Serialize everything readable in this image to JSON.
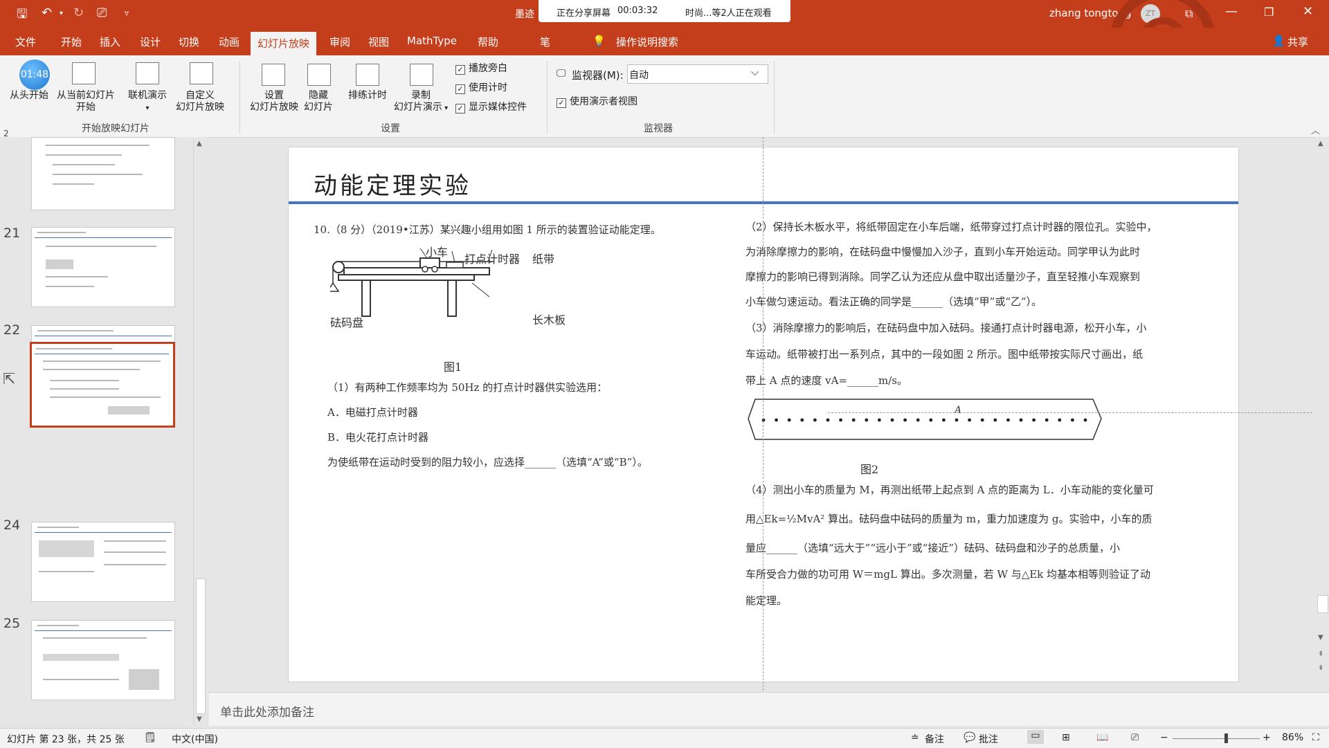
{
  "titlebar": {
    "doc_prefix": "墨迹",
    "share_status": "正在分享屏幕",
    "share_timer": "00:03:32",
    "viewers": "时尚...等2人正在观看",
    "user_name": "zhang tongtong",
    "user_initials": "ZT"
  },
  "tabs": [
    "文件",
    "开始",
    "插入",
    "设计",
    "切换",
    "动画",
    "幻灯片放映",
    "审阅",
    "视图",
    "MathType",
    "帮助",
    "笔"
  ],
  "active_tab": "幻灯片放映",
  "search_label": "操作说明搜索",
  "share_label": "共享",
  "ribbon": {
    "timer_badge": "01:48",
    "from_start": "从头开始",
    "from_current_1": "从当前幻灯片",
    "from_current_2": "开始",
    "online_1": "联机演示",
    "custom_1": "自定义",
    "custom_2": "幻灯片放映",
    "group_start": "开始放映幻灯片",
    "setup_1": "设置",
    "setup_2": "幻灯片放映",
    "hide_1": "隐藏",
    "hide_2": "幻灯片",
    "rehearse": "排练计时",
    "record_1": "录制",
    "record_2": "幻灯片演示",
    "chk_narration": "播放旁白",
    "chk_timing": "使用计时",
    "chk_media": "显示媒体控件",
    "group_setup": "设置",
    "monitor_label": "监视器(M):",
    "monitor_value": "自动",
    "chk_presenter": "使用演示者视图",
    "group_monitor": "监视器"
  },
  "thumbnails": [
    {
      "num": "",
      "selected": false
    },
    {
      "num": "21",
      "selected": false
    },
    {
      "num": "22",
      "selected": false
    },
    {
      "num": "",
      "selected": true
    },
    {
      "num": "24",
      "selected": false
    },
    {
      "num": "25",
      "selected": false
    }
  ],
  "slide": {
    "title": "动能定理实验",
    "q_intro": "10.（8 分）（2019•江苏）某兴趣小组用如图 1 所示的装置验证动能定理。",
    "fig1_cart": "小车",
    "fig1_timer": "打点计时器",
    "fig1_tape": "纸带",
    "fig1_weight": "砝码盘",
    "fig1_board": "长木板",
    "fig1_caption": "图1",
    "q1": "（1）有两种工作频率均为 50Hz 的打点计时器供实验选用：",
    "optA": "A．电磁打点计时器",
    "optB": "B．电火花打点计时器",
    "q1_ask": "为使纸带在运动时受到的阻力较小，应选择______（选填“A”或“B”）。",
    "q2_l1": "（2）保持长木板水平，将纸带固定在小车后端，纸带穿过打点计时器的限位孔。实验中，",
    "q2_l2": "为消除摩擦力的影响，在砝码盘中慢慢加入沙子，直到小车开始运动。同学甲认为此时",
    "q2_l3": "摩擦力的影响已得到消除。同学乙认为还应从盘中取出适量沙子，直至轻推小车观察到",
    "q2_l4": "小车做匀速运动。看法正确的同学是______（选填“甲”或“乙”）。",
    "q3_l1": "（3）消除摩擦力的影响后，在砝码盘中加入砝码。接通打点计时器电源，松开小车，小",
    "q3_l2": "车运动。纸带被打出一系列点，其中的一段如图 2 所示。图中纸带按实际尺寸画出，纸",
    "q3_l3": "带上 A 点的速度 vA=______m/s。",
    "fig2_point": "A",
    "fig2_caption": "图2",
    "q4_l1": "（4）测出小车的质量为 M，再测出纸带上起点到 A 点的距离为 L．小车动能的变化量可",
    "q4_l2": "用△Ek=½MvA² 算出。砝码盘中砝码的质量为 m，重力加速度为 g。实验中，小车的质",
    "q4_l3": "量应______（选填“远大于”“远小于”或“接近”）砝码、砝码盘和沙子的总质量，小",
    "q4_l4": "车所受合力做的功可用 W＝mgL 算出。多次测量，若 W 与△Ek 均基本相等则验证了动",
    "q4_l5": "能定理。"
  },
  "notes_placeholder": "单击此处添加备注",
  "status": {
    "slide_info": "幻灯片 第 23 张，共 25 张",
    "language": "中文(中国)",
    "notes_btn": "备注",
    "comments_btn": "批注",
    "zoom": "86%",
    "zoom_fraction": 0.86
  },
  "colors": {
    "accent": "#c43e1c",
    "slide_rule": "#4472c4"
  }
}
